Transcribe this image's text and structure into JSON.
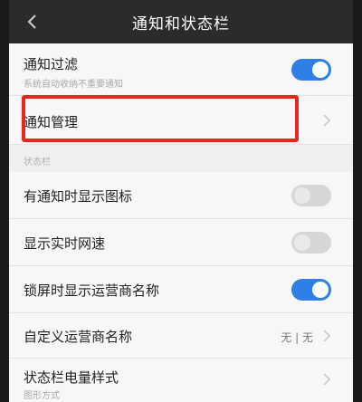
{
  "header": {
    "title": "通知和状态栏",
    "back_icon": "chevron-left-icon"
  },
  "rows": {
    "filter": {
      "label": "通知过滤",
      "sub": "系统自动收纳不重要通知",
      "toggle": "on"
    },
    "manage": {
      "label": "通知管理"
    },
    "section_label": "状态栏",
    "show_icon": {
      "label": "有通知时显示图标",
      "toggle": "off"
    },
    "net_speed": {
      "label": "显示实时网速",
      "toggle": "off"
    },
    "carrier_lock": {
      "label": "锁屏时显示运营商名称",
      "toggle": "on"
    },
    "carrier_custom": {
      "label": "自定义运营商名称",
      "value": "无 | 无"
    },
    "battery_style": {
      "label": "状态栏电量样式",
      "sub": "图形方式"
    }
  },
  "colors": {
    "accent": "#2f7fe6",
    "highlight": "#e8261c",
    "titlebar": "#2b2b2d"
  }
}
